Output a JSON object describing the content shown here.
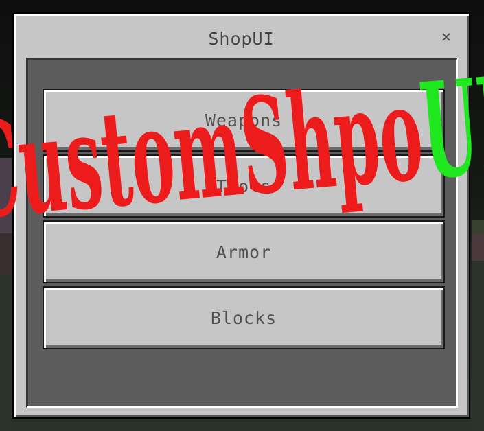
{
  "dialog": {
    "title": "ShopUI",
    "close_glyph": "✕"
  },
  "buttons": [
    {
      "label": "Weapons"
    },
    {
      "label": "Tools"
    },
    {
      "label": "Armor"
    },
    {
      "label": "Blocks"
    }
  ],
  "overlay": {
    "part1": "CustomShpo",
    "part2": "UI",
    "part1_color": "#ec1c1c",
    "part2_color": "#1fe81f"
  }
}
